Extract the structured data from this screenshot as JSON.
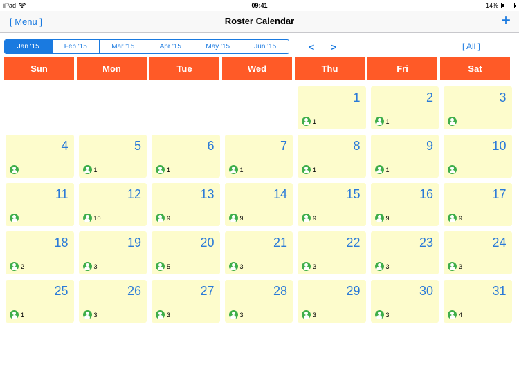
{
  "status_bar": {
    "device": "iPad",
    "time": "09:41",
    "battery": "14%",
    "battery_level": 0.14
  },
  "nav": {
    "menu_label": "[ Menu ]",
    "title": "Roster Calendar",
    "add_label": "+"
  },
  "months": [
    {
      "label": "Jan '15",
      "active": true
    },
    {
      "label": "Feb '15",
      "active": false
    },
    {
      "label": "Mar '15",
      "active": false
    },
    {
      "label": "Apr '15",
      "active": false
    },
    {
      "label": "May '15",
      "active": false
    },
    {
      "label": "Jun '15",
      "active": false
    }
  ],
  "controls": {
    "prev": "<",
    "next": ">",
    "all": "[ All ]"
  },
  "weekdays": [
    "Sun",
    "Mon",
    "Tue",
    "Wed",
    "Thu",
    "Fri",
    "Sat"
  ],
  "leading_blank_days": 4,
  "days": [
    {
      "day": "1",
      "count": "1"
    },
    {
      "day": "2",
      "count": "1"
    },
    {
      "day": "3",
      "count": ""
    },
    {
      "day": "4",
      "count": ""
    },
    {
      "day": "5",
      "count": "1"
    },
    {
      "day": "6",
      "count": "1"
    },
    {
      "day": "7",
      "count": "1"
    },
    {
      "day": "8",
      "count": "1"
    },
    {
      "day": "9",
      "count": "1"
    },
    {
      "day": "10",
      "count": ""
    },
    {
      "day": "11",
      "count": ""
    },
    {
      "day": "12",
      "count": "10"
    },
    {
      "day": "13",
      "count": "9"
    },
    {
      "day": "14",
      "count": "9"
    },
    {
      "day": "15",
      "count": "9"
    },
    {
      "day": "16",
      "count": "9"
    },
    {
      "day": "17",
      "count": "9"
    },
    {
      "day": "18",
      "count": "2"
    },
    {
      "day": "19",
      "count": "3"
    },
    {
      "day": "20",
      "count": "5"
    },
    {
      "day": "21",
      "count": "3"
    },
    {
      "day": "22",
      "count": "3"
    },
    {
      "day": "23",
      "count": "3"
    },
    {
      "day": "24",
      "count": "3"
    },
    {
      "day": "25",
      "count": "1"
    },
    {
      "day": "26",
      "count": "3"
    },
    {
      "day": "27",
      "count": "3"
    },
    {
      "day": "28",
      "count": "3"
    },
    {
      "day": "29",
      "count": "3"
    },
    {
      "day": "30",
      "count": "3"
    },
    {
      "day": "31",
      "count": "4"
    }
  ],
  "colors": {
    "accent": "#1a7ae0",
    "header": "#ff5a27",
    "cell": "#fdfccc",
    "day_number": "#2a7ad8",
    "person_icon": "#3fae4a"
  }
}
